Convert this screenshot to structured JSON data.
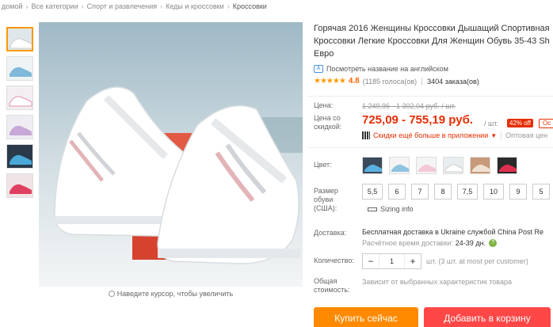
{
  "breadcrumb": {
    "items": [
      "домой",
      "Все категории",
      "Спорт и развлечения",
      "Кеды и кроссовки",
      "Кроссовки"
    ]
  },
  "gallery": {
    "zoom_hint": "Наведите курсор, чтобы увеличить"
  },
  "product": {
    "title": "Горячая 2016 Женщины Кроссовки Дышащий Спортивная Кроссовки Легкие Кроссовки Для Женщин Обувь 35-43 Sh Евро",
    "translate_link": "Посмотреть название на английском",
    "rating": {
      "stars": "★★★★★",
      "score": "4.8",
      "reviews": "(1185 голоса(ов)",
      "orders": "3404 заказа(ов)"
    }
  },
  "price": {
    "label": "Цена:",
    "old": "1 249,96 - 1 302,04 руб. / шт.",
    "discount_label": "Цена со скидкой:",
    "new": "725,09 - 755,19 руб.",
    "per_unit": "/ шт.",
    "discount_badge": "42% off",
    "coupon_badge": "Ос",
    "app_text": "Скидки ещё больше в приложении",
    "wholesale": "Оптовая цен"
  },
  "options": {
    "color_label": "Цвет:",
    "size_label": "Размер обуви (США):",
    "sizes": [
      "5,5",
      "6",
      "7",
      "8",
      "7,5",
      "10",
      "9",
      "5"
    ],
    "sizing_info": "Sizing info"
  },
  "delivery": {
    "label": "Доставка:",
    "text": "Бесплатная доставка в Ukraine службой China Post Re",
    "time_label": "Расчётное время доставки:",
    "time_value": "24-39 дн.",
    "info_icon": "?"
  },
  "quantity": {
    "label": "Количество:",
    "value": "1",
    "minus": "−",
    "plus": "+",
    "stock": "шт. (3 шт. at most per customer)"
  },
  "total": {
    "label": "Общая стоимость:",
    "note": "Зависит от выбранных характеристик товара"
  },
  "actions": {
    "buy_now": "Купить сейчас",
    "add_to_cart": "Добавить в корзину"
  },
  "colors": {
    "accent_price": "#e62e04",
    "buy_button": "#ff8a00",
    "cart_button": "#ff4747",
    "star": "#f90"
  }
}
